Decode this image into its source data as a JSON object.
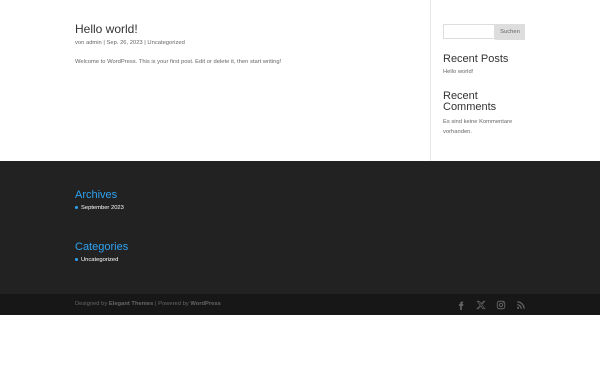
{
  "post": {
    "title": "Hello world!",
    "meta_prefix": "von",
    "author": "admin",
    "date": "Sep. 26, 2023",
    "category": "Uncategorized",
    "sep": "|",
    "excerpt": "Welcome to WordPress. This is your first post. Edit or delete it, then start writing!"
  },
  "sidebar": {
    "search_placeholder": "",
    "search_button": "Suchen",
    "recent_posts_title": "Recent Posts",
    "recent_posts": [
      "Hello world!"
    ],
    "recent_comments_title": "Recent Comments",
    "no_comments": "Es sind keine Kommentare vorhanden."
  },
  "footer": {
    "archives_title": "Archives",
    "archives": [
      "September 2023"
    ],
    "categories_title": "Categories",
    "categories": [
      "Uncategorized"
    ]
  },
  "bottom_bar": {
    "designed_by": "Designed by",
    "theme_author": "Elegant Themes",
    "separator": "|",
    "powered_by": "Powered by",
    "platform": "WordPress",
    "social_icons": [
      "facebook-icon",
      "x-twitter-icon",
      "instagram-icon",
      "rss-icon"
    ]
  },
  "colors": {
    "accent": "#2ea3f2",
    "footer_bg": "#222222",
    "bottom_bar_bg": "#171717"
  }
}
